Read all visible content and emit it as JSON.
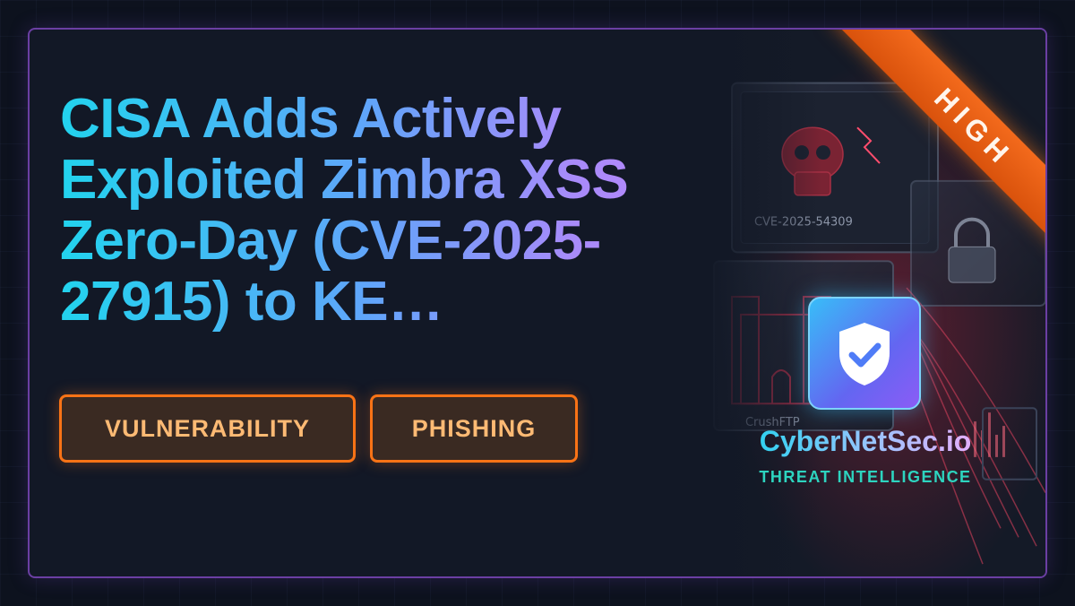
{
  "headline": "CISA Adds Actively Exploited Zimbra XSS Zero-Day (CVE-2025-27915) to KE…",
  "severity": "HIGH",
  "tags": [
    "VULNERABILITY",
    "PHISHING"
  ],
  "brand": {
    "name": "CyberNetSec.io",
    "tagline": "THREAT INTELLIGENCE"
  },
  "artwork": {
    "cve_label": "CVE-2025-54309",
    "server_label": "CrushFTP",
    "icon_names": [
      "skull-icon",
      "castle-icon",
      "padlock-icon",
      "shield-check-icon"
    ]
  },
  "colors": {
    "accent_orange": "#f97316",
    "accent_purple": "#6b3fa3",
    "brand_cyan": "#22d3ee"
  }
}
